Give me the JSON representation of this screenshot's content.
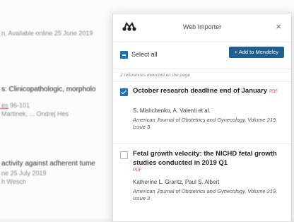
{
  "background": {
    "lines": [
      "n, Available online 25 June 2019",
      "s: Clinicopathologic, morpholo",
      "es 96-101",
      "Martinek, ... Ondrej Hes",
      "activity against adherent tume",
      "ne 25 July 2019",
      "h Wesch"
    ]
  },
  "popup": {
    "title": "Web Importer",
    "close_glyph": "×",
    "select_all_label": "Select all",
    "add_button_label": "+ Add to Mendeley",
    "references_count_text": "2 references detected on the page",
    "references": [
      {
        "checked": true,
        "title": "October research deadline end of January",
        "pdf_label": "PDF",
        "authors": "S. Mishchenko, A. Valenti et al.",
        "journal": "American Journal of Obstetrics and Gynecology, Volume 219, Issue 3"
      },
      {
        "checked": false,
        "title": "Fetal growth velocity: the NICHD fetal growth studies conducted in 2019 Q1",
        "pdf_label": "PDF",
        "authors": "Katherine L. Grantz, Paul S. Albert",
        "journal": "American Journal of Obstetrics and Gynecology, Volume 219, Issue 3"
      }
    ]
  },
  "colors": {
    "accent": "#1a73b8",
    "button": "#1f5f8f",
    "pdf": "#d63a3a"
  },
  "icons": {
    "logo": "mendeley-logo-icon",
    "close": "close-icon"
  }
}
